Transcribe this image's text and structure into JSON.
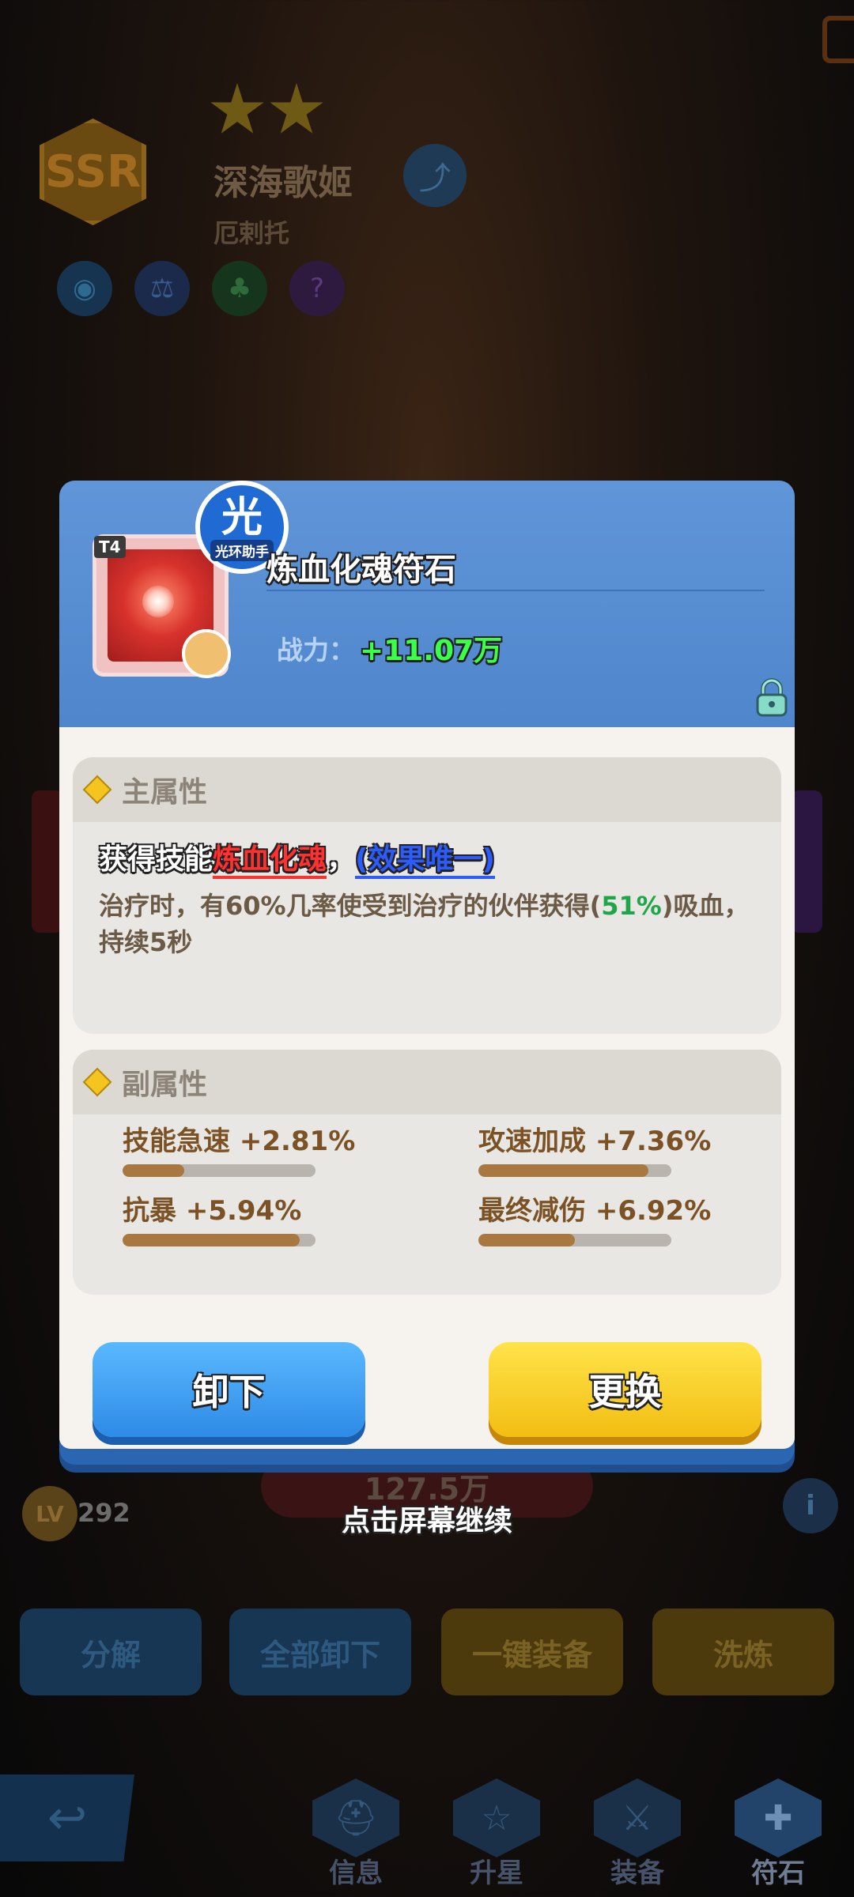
{
  "hero": {
    "rarity": "SSR",
    "stars": 2,
    "name": "深海歌姬",
    "subtitle": "厄剌托",
    "level_label": "LV",
    "level": "292",
    "power_text": "127.5万"
  },
  "background_buttons": {
    "decompose": "分解",
    "unequip_all": "全部卸下",
    "auto_equip": "一键装备",
    "refine": "洗炼"
  },
  "bottom_nav": [
    {
      "label": "信息",
      "icon": "helmet-icon"
    },
    {
      "label": "升星",
      "icon": "star-icon"
    },
    {
      "label": "装备",
      "icon": "sword-icon"
    },
    {
      "label": "符石",
      "icon": "rune-card-icon"
    }
  ],
  "continue_hint": "点击屏幕继续",
  "item": {
    "tier": "T4",
    "name": "炼血化魂符石",
    "aura_char": "光",
    "aura_label": "光环助手",
    "power_label": "战力：",
    "power_value": "+11.07万"
  },
  "main_attr": {
    "title": "主属性",
    "skill_prefix": "获得技能",
    "skill_name": "炼血化魂",
    "skill_comma": "，",
    "unique_tag": "(效果唯一)",
    "desc_part1": "治疗时，有60%几率使受到治疗的伙伴获得(",
    "desc_highlight": "51%",
    "desc_part2": ")吸血，持续5秒"
  },
  "sub_attr": {
    "title": "副属性",
    "stats": [
      {
        "label": "技能急速 +2.81%",
        "fill": 0.32
      },
      {
        "label": "攻速加成 +7.36%",
        "fill": 0.88
      },
      {
        "label": "抗暴 +5.94%",
        "fill": 0.92
      },
      {
        "label": "最终减伤 +6.92%",
        "fill": 0.5
      }
    ]
  },
  "actions": {
    "unequip": "卸下",
    "replace": "更换"
  },
  "colors": {
    "header_blue": "#4f86cc",
    "power_green": "#3cff4a",
    "skill_red": "#ff3030",
    "unique_blue": "#2c5cff",
    "bar_fill": "#a87840"
  }
}
